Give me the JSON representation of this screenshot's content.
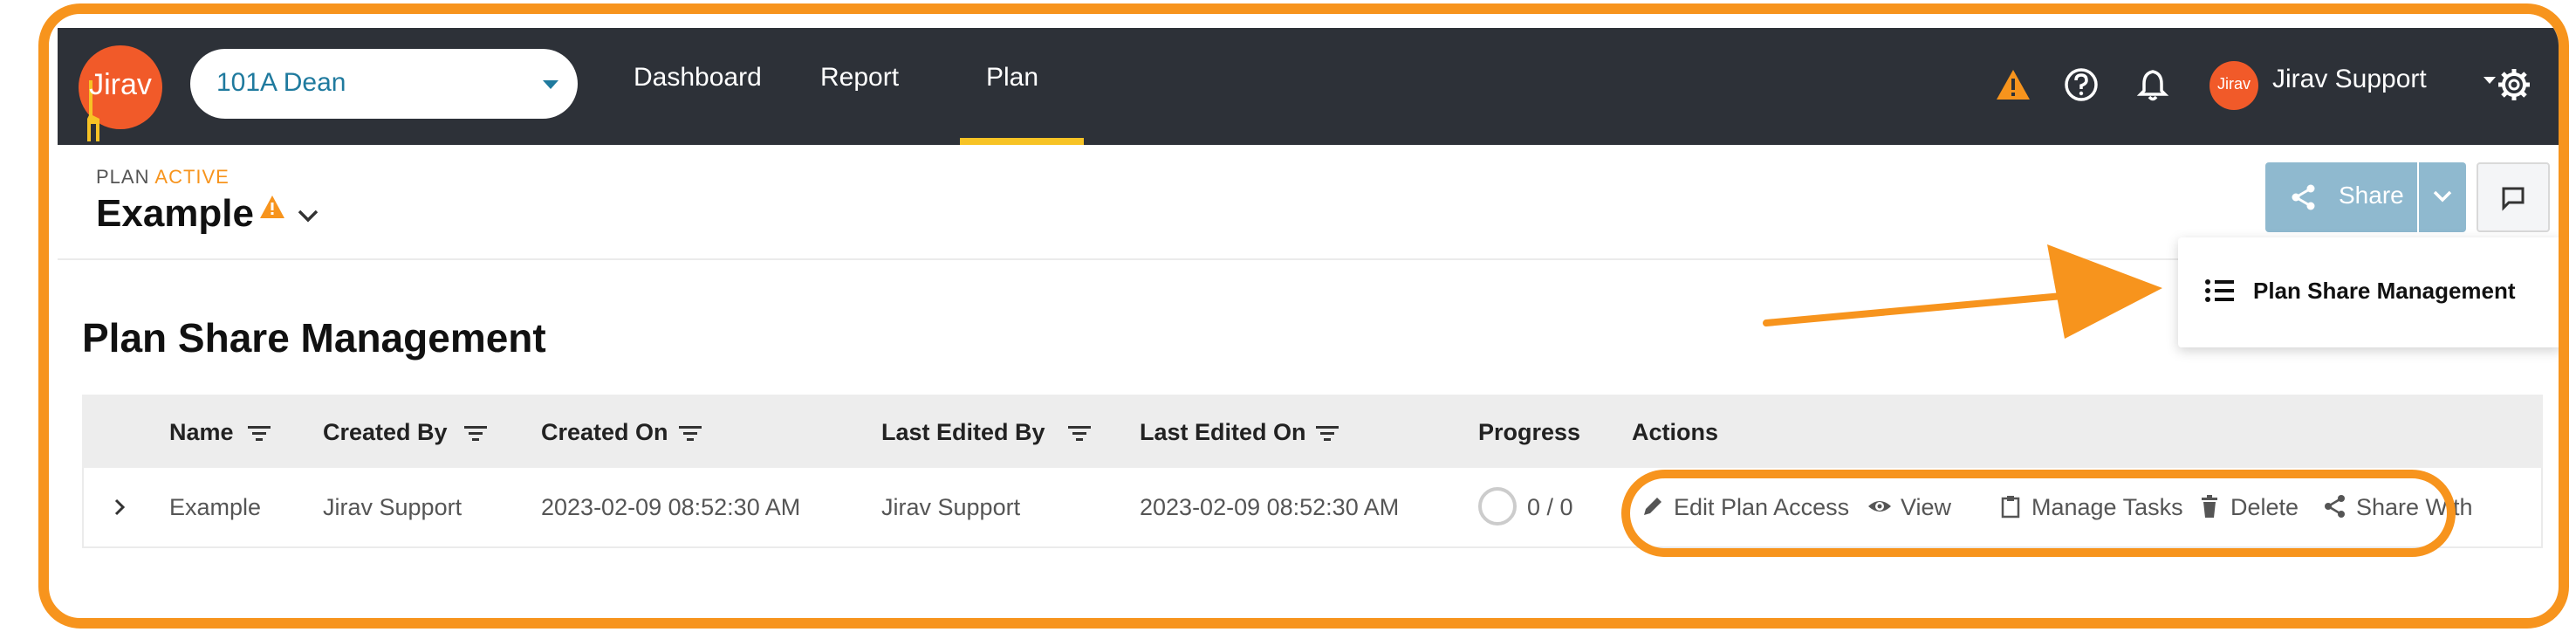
{
  "colors": {
    "accent": "#F7941D",
    "navbar": "#2D3138",
    "share_button": "#8FB9CF",
    "link": "#1F7A9E",
    "active_tab": "#F7C325"
  },
  "navbar": {
    "logo_text": "Jirav",
    "company_select": {
      "value": "101A Dean"
    },
    "tabs": [
      {
        "label": "Dashboard"
      },
      {
        "label": "Report"
      },
      {
        "label": "Plan",
        "active": true
      }
    ],
    "icons": [
      "warning-icon",
      "help-icon",
      "bell-icon",
      "gear-icon"
    ],
    "user": {
      "avatar_text": "Jirav",
      "name": "Jirav Support"
    }
  },
  "plan_header": {
    "status_prefix": "PLAN",
    "status_value": "ACTIVE",
    "title": "Example",
    "share_label": "Share"
  },
  "dropdown": {
    "items": [
      {
        "label": "Plan Share Management",
        "icon": "list-icon"
      }
    ]
  },
  "page": {
    "title": "Plan Share Management"
  },
  "table": {
    "columns": [
      "Name",
      "Created By",
      "Created On",
      "Last Edited By",
      "Last Edited On",
      "Progress",
      "Actions"
    ],
    "rows": [
      {
        "name": "Example",
        "created_by": "Jirav Support",
        "created_on": "2023-02-09 08:52:30 AM",
        "last_edited_by": "Jirav Support",
        "last_edited_on": "2023-02-09 08:52:30 AM",
        "progress": "0 / 0",
        "actions": [
          {
            "label": "Edit Plan Access",
            "icon": "pencil-icon"
          },
          {
            "label": "View",
            "icon": "eye-icon"
          },
          {
            "label": "Manage Tasks",
            "icon": "clipboard-icon"
          },
          {
            "label": "Delete",
            "icon": "trash-icon"
          },
          {
            "label": "Share With",
            "icon": "share-icon"
          }
        ]
      }
    ]
  }
}
